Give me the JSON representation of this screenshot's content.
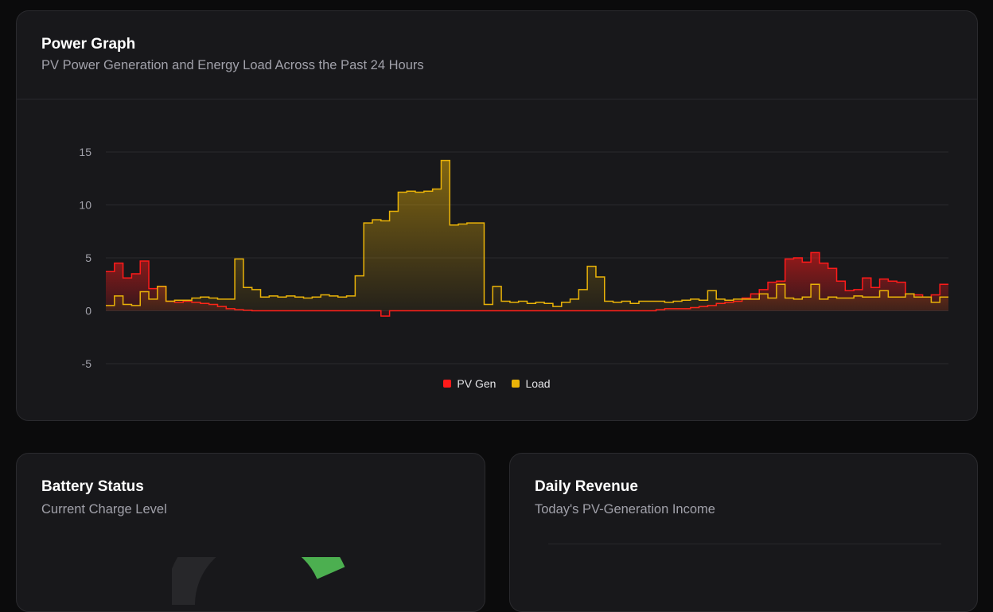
{
  "power_graph": {
    "title": "Power Graph",
    "subtitle": "PV Power Generation and Energy Load Across the Past 24 Hours",
    "legend": [
      {
        "label": "PV Gen",
        "color": "#ff1a1a"
      },
      {
        "label": "Load",
        "color": "#eab308"
      }
    ]
  },
  "battery": {
    "title": "Battery Status",
    "subtitle": "Current Charge Level",
    "colors": {
      "filled": "#4caf50",
      "track": "#27272a"
    }
  },
  "revenue": {
    "title": "Daily Revenue",
    "subtitle": "Today's PV-Generation Income"
  },
  "chart_data": {
    "type": "area",
    "step": true,
    "ylim": [
      -5,
      15
    ],
    "yticks": [
      15,
      10,
      5,
      0,
      -5
    ],
    "grid": true,
    "legend_position": "bottom-center",
    "x": [
      0,
      1,
      2,
      3,
      4,
      5,
      6,
      7,
      8,
      9,
      10,
      11,
      12,
      13,
      14,
      15,
      16,
      17,
      18,
      19,
      20,
      21,
      22,
      23,
      24,
      25,
      26,
      27,
      28,
      29,
      30,
      31,
      32,
      33,
      34,
      35,
      36,
      37,
      38,
      39,
      40,
      41,
      42,
      43,
      44,
      45,
      46,
      47,
      48,
      49,
      50,
      51,
      52,
      53,
      54,
      55,
      56,
      57,
      58,
      59,
      60,
      61,
      62,
      63,
      64,
      65,
      66,
      67,
      68,
      69,
      70,
      71,
      72,
      73,
      74,
      75,
      76,
      77,
      78,
      79,
      80,
      81,
      82,
      83,
      84,
      85,
      86,
      87,
      88,
      89,
      90,
      91,
      92,
      93,
      94,
      95,
      96,
      97
    ],
    "series": [
      {
        "name": "PV Gen",
        "color": "#ff1a1a",
        "values": [
          3.7,
          4.5,
          3.1,
          3.5,
          4.7,
          2.1,
          2.3,
          0.9,
          0.8,
          0.9,
          0.8,
          0.7,
          0.6,
          0.4,
          0.2,
          0.1,
          0.05,
          0,
          0,
          0,
          0,
          0,
          0,
          0,
          0,
          0,
          0,
          0,
          0,
          0,
          0,
          0,
          -0.5,
          0,
          0,
          0,
          0,
          0,
          0,
          0,
          0,
          0,
          0,
          0,
          0,
          0,
          0,
          0,
          0,
          0,
          0,
          0,
          0,
          0,
          0,
          0,
          0,
          0,
          0,
          0,
          0,
          0,
          0,
          0,
          0.1,
          0.2,
          0.2,
          0.2,
          0.3,
          0.4,
          0.5,
          0.7,
          0.8,
          0.9,
          1.2,
          1.6,
          2.0,
          2.7,
          2.8,
          4.9,
          5.0,
          4.6,
          5.5,
          4.5,
          4.0,
          2.8,
          1.9,
          2.0,
          3.1,
          2.2,
          3.0,
          2.8,
          2.7,
          1.6,
          1.5,
          1.3,
          1.5,
          2.5
        ]
      },
      {
        "name": "Load",
        "color": "#eab308",
        "values": [
          0.5,
          1.4,
          0.6,
          0.5,
          1.8,
          1.1,
          2.3,
          0.9,
          1.0,
          1.0,
          1.2,
          1.3,
          1.2,
          1.1,
          1.1,
          4.9,
          2.2,
          2.0,
          1.3,
          1.4,
          1.3,
          1.4,
          1.3,
          1.2,
          1.3,
          1.5,
          1.4,
          1.3,
          1.4,
          3.3,
          8.3,
          8.6,
          8.5,
          9.4,
          11.2,
          11.3,
          11.2,
          11.3,
          11.5,
          14.2,
          8.1,
          8.2,
          8.3,
          8.3,
          0.6,
          2.3,
          0.9,
          0.8,
          0.9,
          0.7,
          0.8,
          0.7,
          0.4,
          0.8,
          1.1,
          2.0,
          4.2,
          3.2,
          0.9,
          0.8,
          0.9,
          0.7,
          0.9,
          0.9,
          0.9,
          0.8,
          0.9,
          1.0,
          1.1,
          1.0,
          1.9,
          1.1,
          1.0,
          1.1,
          1.1,
          1.1,
          1.6,
          1.2,
          2.5,
          1.2,
          1.1,
          1.3,
          2.5,
          1.1,
          1.3,
          1.2,
          1.2,
          1.4,
          1.3,
          1.3,
          1.9,
          1.3,
          1.3,
          1.6,
          1.3,
          1.3,
          0.8,
          1.3
        ]
      }
    ]
  }
}
